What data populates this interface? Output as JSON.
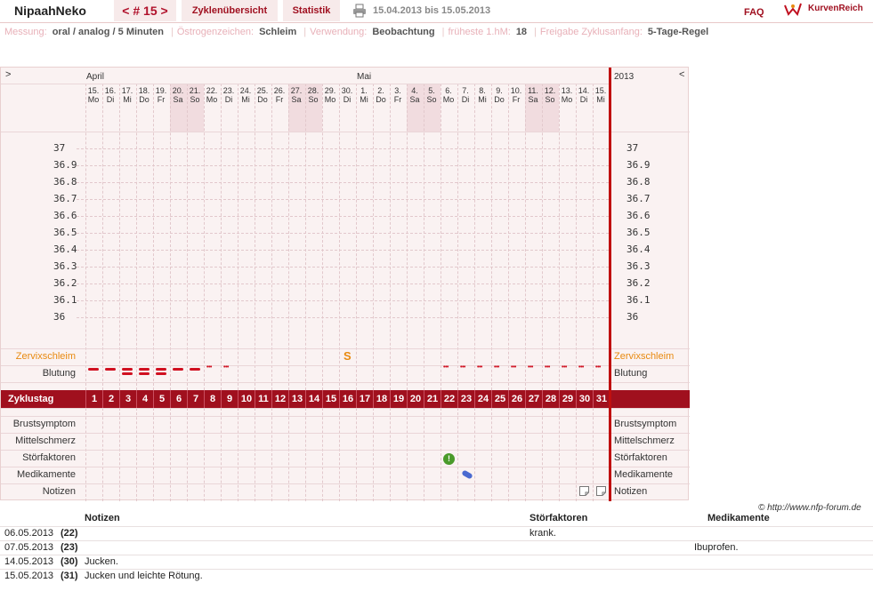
{
  "header": {
    "user": "NipaahNeko",
    "cycle": "< # 15 >",
    "overview": "Zyklenübersicht",
    "stats": "Statistik",
    "date_range": "15.04.2013 bis 15.05.2013",
    "faq": "FAQ",
    "logo": "KurvenReich"
  },
  "info": [
    {
      "label": "Messung:",
      "value": "oral / analog / 5 Minuten"
    },
    {
      "label": "Östrogenzeichen:",
      "value": "Schleim"
    },
    {
      "label": "Verwendung:",
      "value": "Beobachtung"
    },
    {
      "label": "früheste 1.hM:",
      "value": "18"
    },
    {
      "label": "Freigabe Zyklusanfang:",
      "value": "5-Tage-Regel"
    }
  ],
  "chart": {
    "month_april": "April",
    "month_may": "Mai",
    "year": "2013",
    "left_arrow": ">",
    "right_arrow": "<",
    "days": [
      {
        "d": "15.",
        "w": "Mo"
      },
      {
        "d": "16.",
        "w": "Di"
      },
      {
        "d": "17.",
        "w": "Mi"
      },
      {
        "d": "18.",
        "w": "Do"
      },
      {
        "d": "19.",
        "w": "Fr"
      },
      {
        "d": "20.",
        "w": "Sa"
      },
      {
        "d": "21.",
        "w": "So"
      },
      {
        "d": "22.",
        "w": "Mo"
      },
      {
        "d": "23.",
        "w": "Di"
      },
      {
        "d": "24.",
        "w": "Mi"
      },
      {
        "d": "25.",
        "w": "Do"
      },
      {
        "d": "26.",
        "w": "Fr"
      },
      {
        "d": "27.",
        "w": "Sa"
      },
      {
        "d": "28.",
        "w": "So"
      },
      {
        "d": "29.",
        "w": "Mo"
      },
      {
        "d": "30.",
        "w": "Di"
      },
      {
        "d": "1.",
        "w": "Mi"
      },
      {
        "d": "2.",
        "w": "Do"
      },
      {
        "d": "3.",
        "w": "Fr"
      },
      {
        "d": "4.",
        "w": "Sa"
      },
      {
        "d": "5.",
        "w": "So"
      },
      {
        "d": "6.",
        "w": "Mo"
      },
      {
        "d": "7.",
        "w": "Di"
      },
      {
        "d": "8.",
        "w": "Mi"
      },
      {
        "d": "9.",
        "w": "Do"
      },
      {
        "d": "10.",
        "w": "Fr"
      },
      {
        "d": "11.",
        "w": "Sa"
      },
      {
        "d": "12.",
        "w": "So"
      },
      {
        "d": "13.",
        "w": "Mo"
      },
      {
        "d": "14.",
        "w": "Di"
      },
      {
        "d": "15.",
        "w": "Mi"
      }
    ],
    "temps": [
      "37",
      "36.9",
      "36.8",
      "36.7",
      "36.6",
      "36.5",
      "36.4",
      "36.3",
      "36.2",
      "36.1",
      "36"
    ],
    "row_zervix": "Zervixschleim",
    "row_blutung": "Blutung",
    "row_zyklustag": "Zyklustag",
    "row_brust": "Brustsymptom",
    "row_mittel": "Mittelschmerz",
    "row_stoer": "Störfaktoren",
    "row_medi": "Medikamente",
    "row_notizen": "Notizen",
    "mucus_symbol": "S",
    "mucus_day": 16,
    "bleeding": [
      2,
      2,
      3,
      3,
      3,
      2,
      2,
      1,
      1,
      0,
      0,
      0,
      0,
      0,
      0,
      0,
      0,
      0,
      0,
      0,
      0,
      1,
      1,
      1,
      1,
      1,
      1,
      1,
      1,
      1,
      1
    ],
    "stoer_day": 22,
    "stoer_symbol": "!",
    "medi_day": 23,
    "note_days": [
      30,
      31
    ],
    "cycle_days": [
      "1",
      "2",
      "3",
      "4",
      "5",
      "6",
      "7",
      "8",
      "9",
      "10",
      "11",
      "12",
      "13",
      "14",
      "15",
      "16",
      "17",
      "18",
      "19",
      "20",
      "21",
      "22",
      "23",
      "24",
      "25",
      "26",
      "27",
      "28",
      "29",
      "30",
      "31"
    ]
  },
  "copyright": "© http://www.nfp-forum.de",
  "notes": {
    "h_notes": "Notizen",
    "h_stoer": "Störfaktoren",
    "h_medi": "Medikamente",
    "rows": [
      {
        "date": "06.05.2013",
        "day": "(22)",
        "note": "",
        "stoer": "krank.",
        "medi": ""
      },
      {
        "date": "07.05.2013",
        "day": "(23)",
        "note": "",
        "stoer": "",
        "medi": "Ibuprofen."
      },
      {
        "date": "14.05.2013",
        "day": "(30)",
        "note": "Jucken.",
        "stoer": "",
        "medi": ""
      },
      {
        "date": "15.05.2013",
        "day": "(31)",
        "note": "Jucken und leichte Rötung.",
        "stoer": "",
        "medi": ""
      }
    ]
  },
  "colors": {
    "accent": "#a0101e",
    "mucus": "#e88a10",
    "blood": "#d01020"
  }
}
